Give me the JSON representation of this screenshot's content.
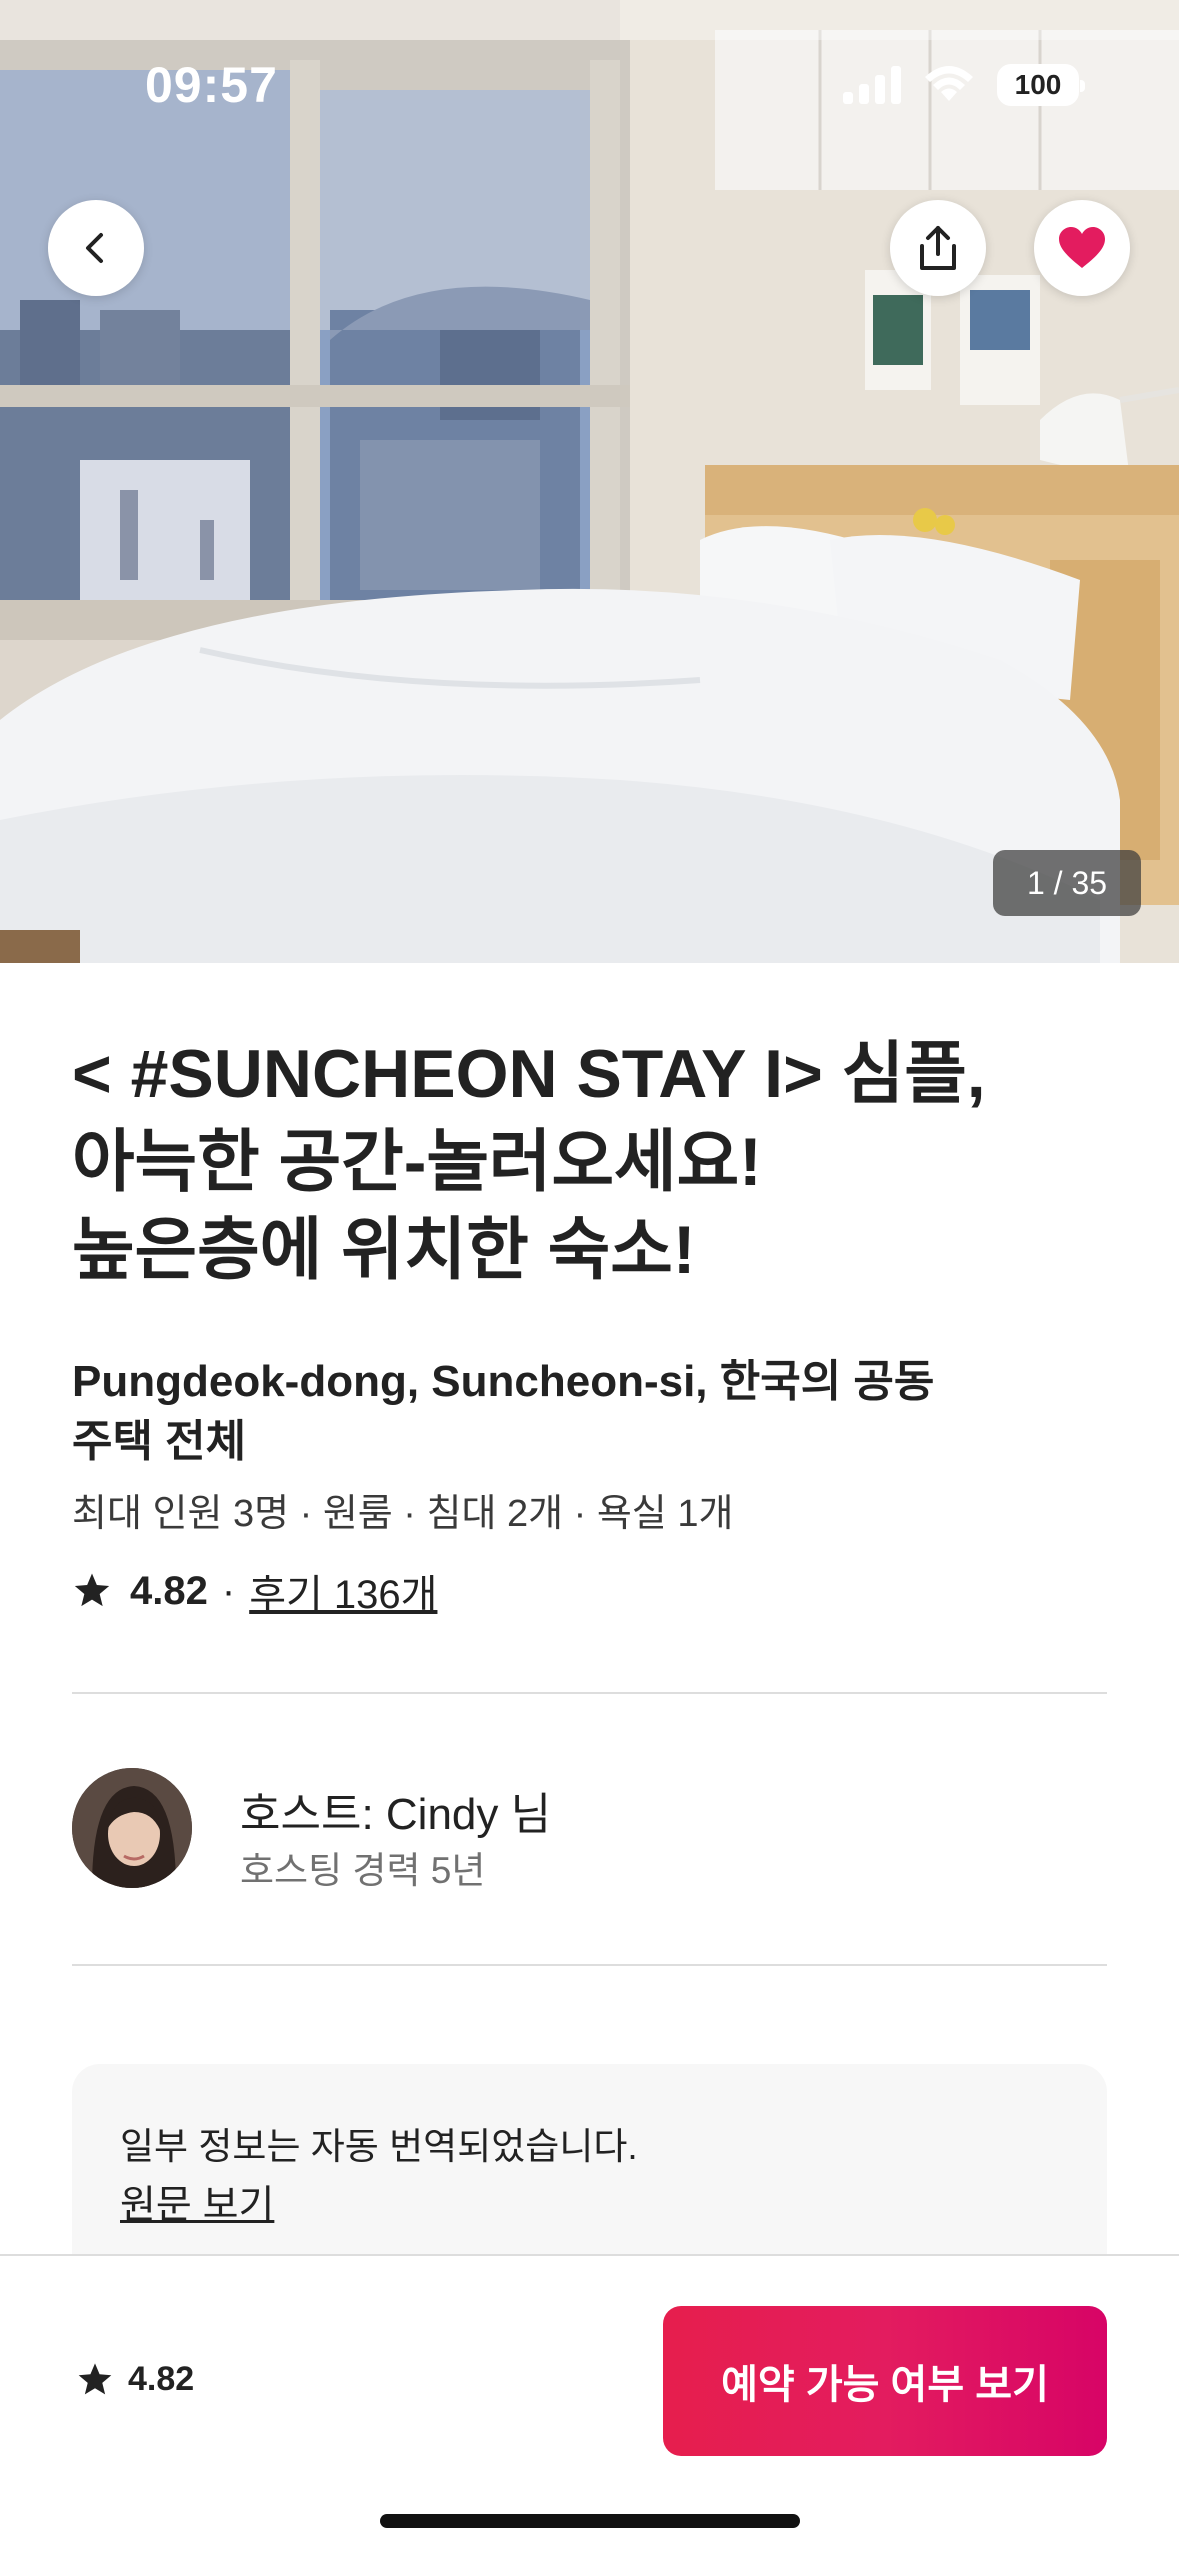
{
  "status_bar": {
    "time": "09:57",
    "battery": "100",
    "icons": [
      "signal-icon",
      "wifi-icon",
      "battery-icon"
    ]
  },
  "header": {
    "back_icon": "chevron-left-icon",
    "share_icon": "share-icon",
    "favorite_icon": "heart-icon",
    "photo_counter": "1 / 35"
  },
  "listing": {
    "title_lines": [
      "< #SUNCHEON STAY I> 심플,",
      "아늑한 공간-놀러오세요!",
      "높은층에 위치한 숙소!"
    ],
    "subtitle_lines": [
      "Pungdeok-dong, Suncheon-si, 한국의 공동",
      "주택 전체"
    ],
    "specs": "최대 인원 3명 · 원룸 · 침대 2개 · 욕실 1개",
    "rating": "4.82",
    "separator": "·",
    "reviews": "후기 136개"
  },
  "host": {
    "name": "호스트: Cindy 님",
    "experience": "호스팅 경력 5년"
  },
  "translation": {
    "notice": "일부 정보는 자동 번역되었습니다.",
    "link": "원문 보기"
  },
  "bottom_bar": {
    "rating": "4.82",
    "cta_label": "예약 가능 여부 보기"
  },
  "colors": {
    "brand": "#E31C5F",
    "favorite": "#E31C5F",
    "text": "#222222",
    "muted": "#717171",
    "divider": "#DDDDDD"
  }
}
